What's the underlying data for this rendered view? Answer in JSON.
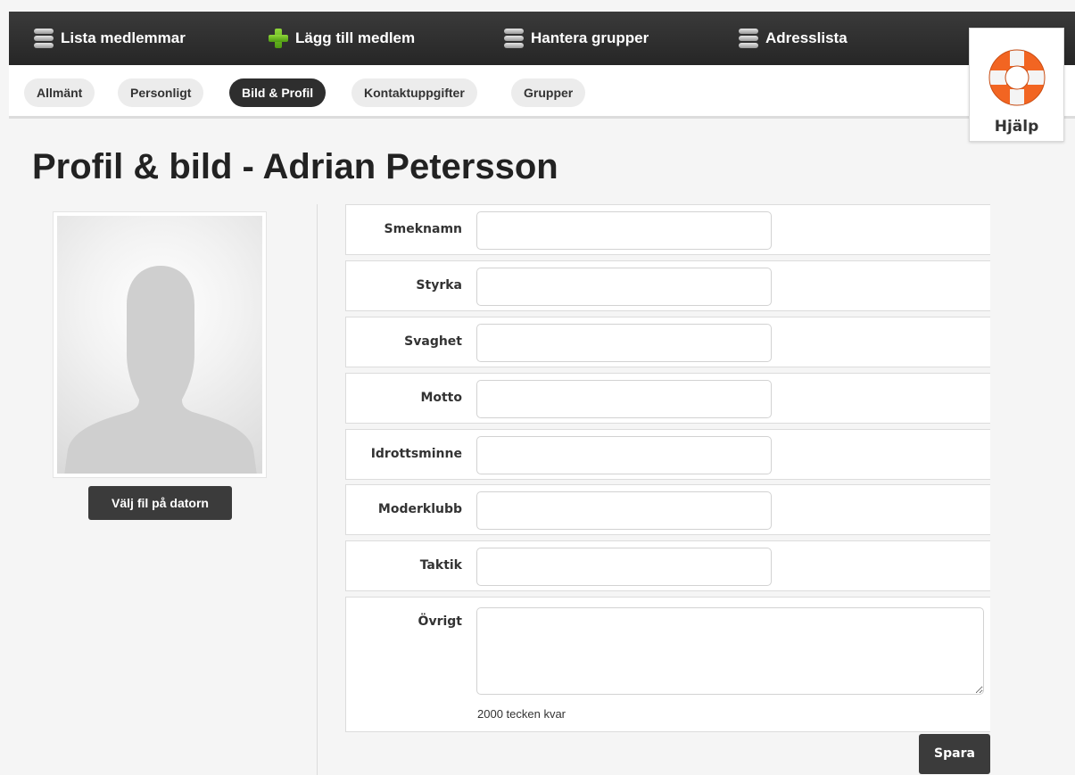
{
  "nav": {
    "items": [
      {
        "label": "Lista medlemmar",
        "icon": "stack-icon"
      },
      {
        "label": "Lägg till medlem",
        "icon": "plus-icon"
      },
      {
        "label": "Hantera grupper",
        "icon": "stack-icon"
      },
      {
        "label": "Adresslista",
        "icon": "stack-icon"
      }
    ]
  },
  "tabs": [
    {
      "label": "Allmänt"
    },
    {
      "label": "Personligt"
    },
    {
      "label": "Bild & Profil",
      "active": true
    },
    {
      "label": "Kontaktuppgifter"
    },
    {
      "label": "Grupper"
    }
  ],
  "help": {
    "label": "Hjälp",
    "icon": "lifebuoy-icon"
  },
  "page": {
    "title": "Profil & bild - Adrian Petersson"
  },
  "photo": {
    "button_label": "Välj fil på datorn",
    "icon": "person-silhouette-icon"
  },
  "form": {
    "fields": [
      {
        "label": "Smeknamn",
        "value": ""
      },
      {
        "label": "Styrka",
        "value": ""
      },
      {
        "label": "Svaghet",
        "value": ""
      },
      {
        "label": "Motto",
        "value": ""
      },
      {
        "label": "Idrottsminne",
        "value": ""
      },
      {
        "label": "Moderklubb",
        "value": ""
      },
      {
        "label": "Taktik",
        "value": ""
      }
    ],
    "ovrigt": {
      "label": "Övrigt",
      "value": "",
      "chars_left": "2000 tecken kvar"
    },
    "save_label": "Spara"
  },
  "colors": {
    "nav_bg": "#2e2e2e",
    "active_tab": "#2e2e2e",
    "lifebuoy": "#f26522"
  }
}
